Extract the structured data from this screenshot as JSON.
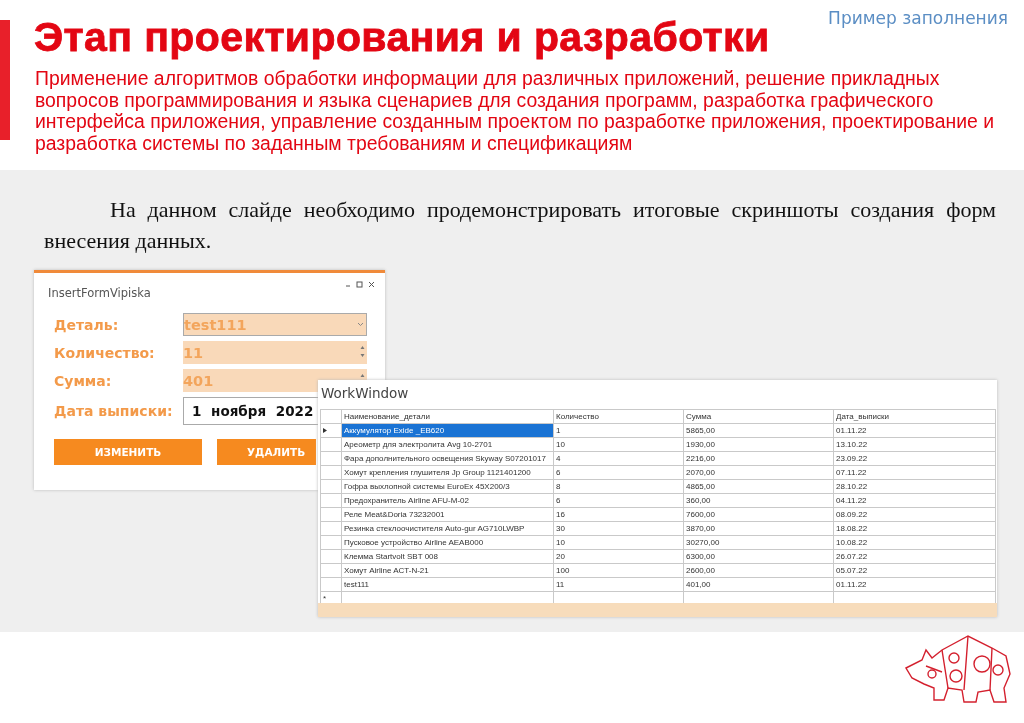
{
  "header": {
    "title": "Этап проектирования и разработки",
    "tag": "Пример заполнения",
    "subtitle": "Применение алгоритмов обработки информации для различных приложений, решение прикладных вопросов программирования и языка сценариев для создания программ, разработка графического интерфейса приложения, управление созданным проектом по разработке приложения, проектирование и разработка системы по заданным требованиям и спецификациям"
  },
  "body_text": "На данном слайде необходимо продемонстрировать итоговые скриншоты создания форм внесения данных.",
  "insert_window": {
    "title": "InsertFormVipiska",
    "fields": [
      {
        "label": "Деталь:",
        "value": "test111",
        "kind": "combo"
      },
      {
        "label": "Количество:",
        "value": "11",
        "kind": "spin"
      },
      {
        "label": "Сумма:",
        "value": "401",
        "kind": "spin"
      },
      {
        "label": "Дата выписки:",
        "value": "1 ноября 2022",
        "kind": "date"
      }
    ],
    "buttons": [
      "ИЗМЕНИТЬ",
      "УДАЛИТЬ"
    ]
  },
  "work_window": {
    "title": "WorkWindow",
    "table": {
      "columns": [
        "Наименование_детали",
        "Количество",
        "Сумма",
        "Дата_выписки"
      ],
      "rows": [
        {
          "cells": [
            "Аккумулятор Exide _EB620",
            "1",
            "5865,00",
            "01.11.22"
          ],
          "selected": true
        },
        {
          "cells": [
            "Ареометр для электролита Avg 10-2701",
            "10",
            "1930,00",
            "13.10.22"
          ],
          "selected": false
        },
        {
          "cells": [
            "Фара дополнительного освещения Skyway S07201017",
            "4",
            "2216,00",
            "23.09.22"
          ],
          "selected": false
        },
        {
          "cells": [
            "Хомут крепления глушителя Jp Group 1121401200",
            "6",
            "2070,00",
            "07.11.22"
          ],
          "selected": false
        },
        {
          "cells": [
            "Гофра выхлопной системы EuroEx 45X200/3",
            "8",
            "4865,00",
            "28.10.22"
          ],
          "selected": false
        },
        {
          "cells": [
            "Предохранитель Airline AFU-M-02",
            "6",
            "360,00",
            "04.11.22"
          ],
          "selected": false
        },
        {
          "cells": [
            "Реле Meat&Doria 73232001",
            "16",
            "7600,00",
            "08.09.22"
          ],
          "selected": false
        },
        {
          "cells": [
            "Резинка стеклоочистителя Auto-gur AG710LWBP",
            "30",
            "3870,00",
            "18.08.22"
          ],
          "selected": false
        },
        {
          "cells": [
            "Пусковое устройство Airline AEAB000",
            "10",
            "30270,00",
            "10.08.22"
          ],
          "selected": false
        },
        {
          "cells": [
            "Клемма Startvolt SBT 008",
            "20",
            "6300,00",
            "26.07.22"
          ],
          "selected": false
        },
        {
          "cells": [
            "Хомут Airline ACT-N-21",
            "100",
            "2600,00",
            "05.07.22"
          ],
          "selected": false
        },
        {
          "cells": [
            "test111",
            "11",
            "401,00",
            "01.11.22"
          ],
          "selected": false
        }
      ],
      "new_row_marker": "*"
    }
  }
}
